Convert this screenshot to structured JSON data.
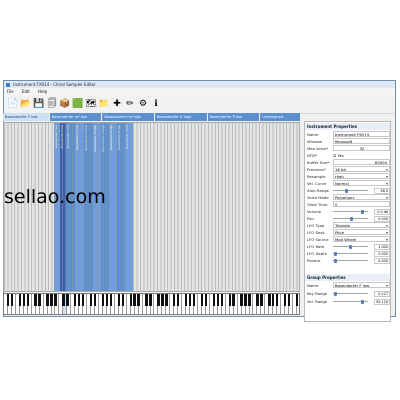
{
  "window": {
    "title": "Instrument FX014 - Chiral Sampler Editor"
  },
  "menu": [
    "File",
    "Edit",
    "Help"
  ],
  "toolbar": [
    {
      "icon": "new-document-icon",
      "glyph": "📄"
    },
    {
      "icon": "open-folder-icon",
      "glyph": "📂"
    },
    {
      "icon": "save-icon",
      "glyph": "💾"
    },
    {
      "icon": "save-as-icon",
      "glyph": "🗐"
    },
    {
      "icon": "package-icon",
      "glyph": "📦"
    },
    {
      "icon": "import-icon",
      "glyph": "🟩"
    },
    {
      "icon": "export-icon",
      "glyph": "🗺"
    },
    {
      "icon": "folder-blue-icon",
      "glyph": "📁"
    },
    {
      "icon": "add-icon",
      "glyph": "✚"
    },
    {
      "icon": "pencil-icon",
      "glyph": "✏"
    },
    {
      "icon": "settings-icon",
      "glyph": "⚙"
    },
    {
      "icon": "info-icon",
      "glyph": "ℹ"
    }
  ],
  "tabs": [
    "Bosendorfer F low",
    "Bosendorfer mf low",
    "Bosendorfer mf high",
    "Bosendorfer ff high",
    "Bosendorfer P low",
    "Unassigned"
  ],
  "active_tab": 0,
  "instrument": {
    "header": "Instrument Properties",
    "name_label": "Name",
    "name": "Instrument P4574",
    "window_label": "Window",
    "window": "Monosoft",
    "maxvoice_label": "Max Voice*",
    "maxvoice": "32",
    "dfd_label": "DFD*",
    "dfd": "Yes",
    "buffer_label": "Buffer Size*",
    "buffer": "65000",
    "precision_label": "Precision*",
    "precision": "16 bit",
    "resample_label": "Resample",
    "resample": "High",
    "velcurve_label": "Vel. Curve",
    "velcurve": "Normal",
    "amprange_label": "Amp Range",
    "amprange": "48.0",
    "voicemode_label": "Voice Mode",
    "voicemode": "Polyphony",
    "glide_label": "Glide Time",
    "glide": "0",
    "volume_label": "Volume",
    "volume": "0.0 db",
    "pan_label": "Pan",
    "pan": "0.000",
    "lfotype_label": "LFO Type",
    "lfotype": "Triangle",
    "lfodest_label": "LFO Dest.",
    "lfodest": "Pitch",
    "lfosource_label": "LFO Source",
    "lfosource": "Mod Wheel",
    "lforate_label": "LFO Rate",
    "lforate": "1.000",
    "lfodepth_label": "LFO Depth",
    "lfodepth": "0.000",
    "reverb_label": "Reverb",
    "reverb": "0.000"
  },
  "group": {
    "header": "Group Properties",
    "name_label": "Name",
    "name": "Bosendorfer F low",
    "keyrange_label": "Key Range",
    "keyrange": "0.127",
    "velrange_label": "Vel. Range",
    "velrange": "95.120"
  },
  "watermark": "sellao.com",
  "colors": {
    "active_zone": "#5a8fd0",
    "zone_dark": "#3b5fa8",
    "accent": "#3b7bd4"
  }
}
